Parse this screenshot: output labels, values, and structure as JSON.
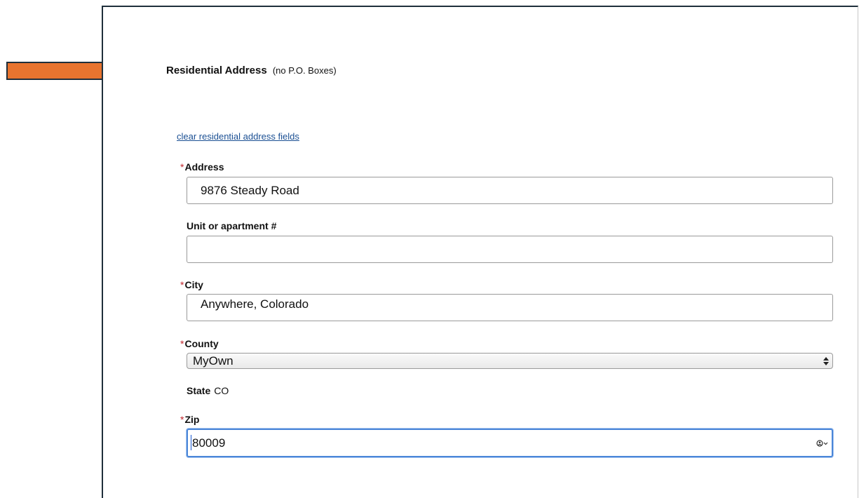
{
  "section": {
    "title": "Residential Address",
    "note": "(no P.O. Boxes)"
  },
  "clear_link": "clear residential address fields",
  "required_mark": "*",
  "fields": {
    "address": {
      "label": "Address",
      "value": "9876 Steady Road"
    },
    "unit": {
      "label": "Unit or apartment #",
      "value": ""
    },
    "city": {
      "label": "City",
      "value": "Anywhere, Colorado"
    },
    "county": {
      "label": "County",
      "value": "MyOwn"
    },
    "state": {
      "label": "State",
      "value": "CO"
    },
    "zip": {
      "label": "Zip",
      "value": "80009"
    }
  },
  "colors": {
    "arrow": "#e8742f",
    "required": "#c0262d",
    "link": "#1a4f93",
    "focus": "#4a86d8"
  },
  "icons": {
    "arrow": "arrow-right-icon",
    "select": "select-updown-icon",
    "autofill": "contact-autofill-icon"
  }
}
